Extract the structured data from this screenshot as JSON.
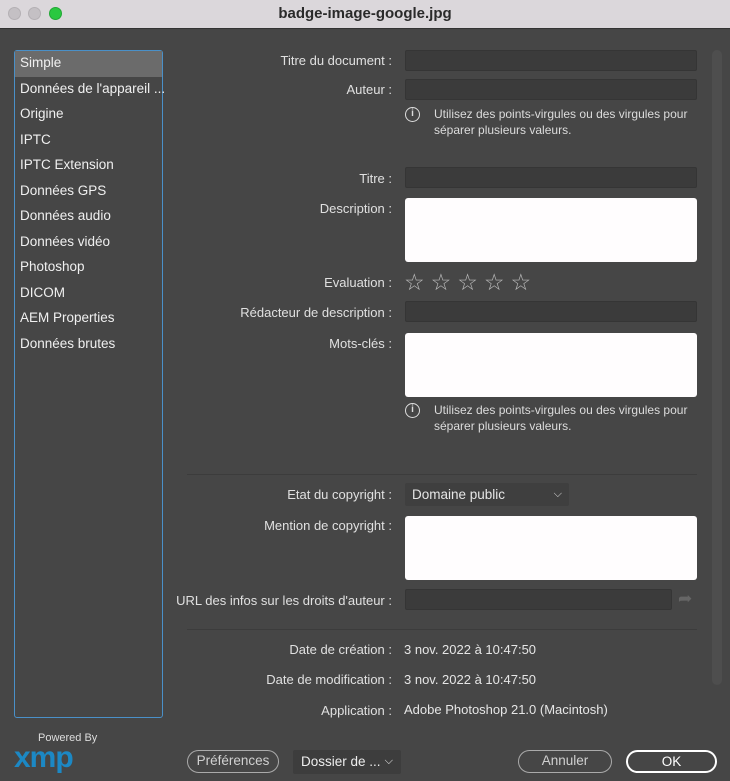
{
  "window": {
    "title": "badge-image-google.jpg"
  },
  "sidebar": {
    "items": [
      {
        "label": "Simple",
        "selected": true
      },
      {
        "label": "Données de l'appareil ..."
      },
      {
        "label": "Origine"
      },
      {
        "label": "IPTC"
      },
      {
        "label": "IPTC Extension"
      },
      {
        "label": "Données GPS"
      },
      {
        "label": "Données audio"
      },
      {
        "label": "Données vidéo"
      },
      {
        "label": "Photoshop"
      },
      {
        "label": "DICOM"
      },
      {
        "label": "AEM Properties"
      },
      {
        "label": "Données brutes"
      }
    ]
  },
  "form": {
    "doc_title_label": "Titre du document :",
    "doc_title_value": "",
    "author_label": "Auteur :",
    "author_value": "",
    "info_text": "Utilisez des points-virgules ou des virgules pour séparer plusieurs valeurs.",
    "title_label": "Titre :",
    "title_value": "",
    "description_label": "Description :",
    "description_value": "",
    "rating_label": "Evaluation :",
    "rating_value": 0,
    "rating_max": 5,
    "desc_writer_label": "Rédacteur de description :",
    "desc_writer_value": "",
    "keywords_label": "Mots-clés :",
    "keywords_value": "",
    "keywords_info": "Utilisez des points-virgules ou des virgules pour séparer plusieurs valeurs.",
    "copyright_status_label": "Etat du copyright :",
    "copyright_status_value": "Domaine public",
    "copyright_notice_label": "Mention de copyright :",
    "copyright_notice_value": "",
    "copyright_url_label": "URL des infos sur les droits d'auteur :",
    "copyright_url_value": "",
    "created_label": "Date de création :",
    "created_value": "3 nov. 2022 à 10:47:50",
    "modified_label": "Date de modification :",
    "modified_value": "3 nov. 2022 à 10:47:50",
    "application_label": "Application :",
    "application_value": "Adobe Photoshop 21.0 (Macintosh)"
  },
  "footer": {
    "powered_by": "Powered By",
    "logo": "xmp",
    "preferences": "Préférences",
    "folder": "Dossier de ...",
    "cancel": "Annuler",
    "ok": "OK"
  },
  "colors": {
    "accent": "#4a90c8",
    "close_button": "#2ac840",
    "xmp_logo": "#1c88c4"
  }
}
